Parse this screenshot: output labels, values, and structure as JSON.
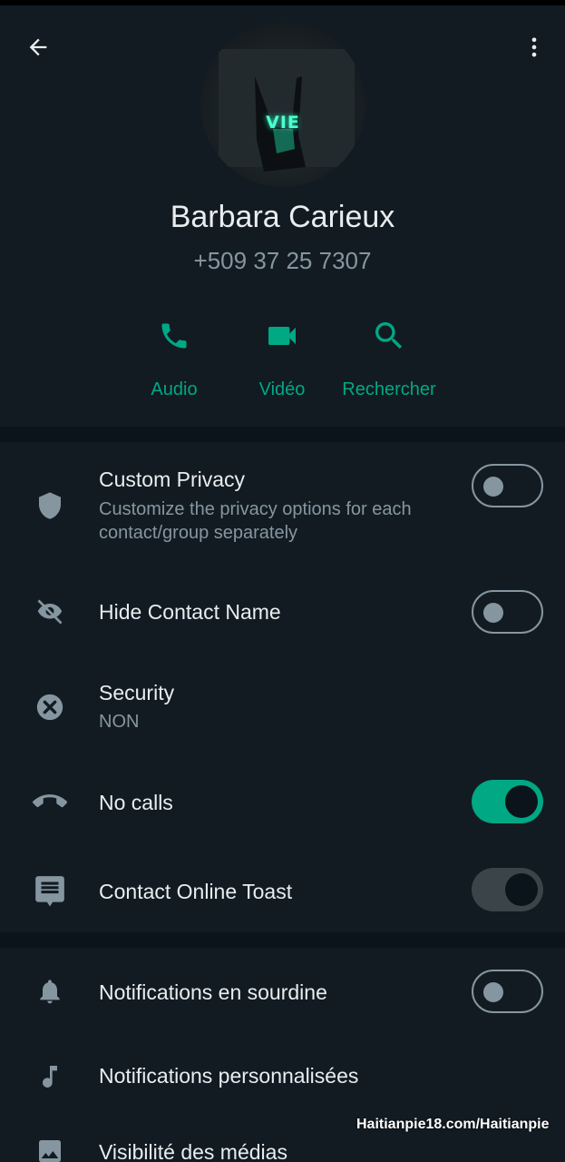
{
  "header": {
    "back_icon": "arrow-left-icon",
    "menu_icon": "more-vertical-icon",
    "avatar_text": "VIE",
    "contact_name": "Barbara Carieux",
    "phone": "+509 37 25 7307"
  },
  "actions": [
    {
      "label": "Audio",
      "icon": "phone-icon"
    },
    {
      "label": "Vidéo",
      "icon": "video-camera-icon"
    },
    {
      "label": "Rechercher",
      "icon": "search-icon"
    }
  ],
  "settings": {
    "custom_privacy": {
      "title": "Custom Privacy",
      "subtitle": "Customize the privacy options for each contact/group separately",
      "enabled": false,
      "icon": "shield-icon"
    },
    "hide_contact_name": {
      "title": "Hide Contact Name",
      "enabled": false,
      "icon": "eye-off-icon"
    },
    "security": {
      "title": "Security",
      "value": "NON",
      "icon": "close-circle-icon"
    },
    "no_calls": {
      "title": "No calls",
      "enabled": true,
      "icon": "call-end-icon"
    },
    "contact_online_toast": {
      "title": "Contact Online Toast",
      "enabled": true,
      "disabled": true,
      "icon": "message-icon"
    }
  },
  "notifications": {
    "mute": {
      "title": "Notifications en sourdine",
      "enabled": false,
      "icon": "bell-icon"
    },
    "custom": {
      "title": "Notifications personnalisées",
      "icon": "music-note-icon"
    },
    "media_visibility": {
      "title": "Visibilité des médias",
      "icon": "image-icon"
    }
  },
  "watermark": "Haitianpie18.com/Haitianpie",
  "colors": {
    "background": "#0b141a",
    "surface": "#121b22",
    "accent": "#00a884",
    "text_primary": "#e9edef",
    "text_secondary": "#8696a0"
  }
}
